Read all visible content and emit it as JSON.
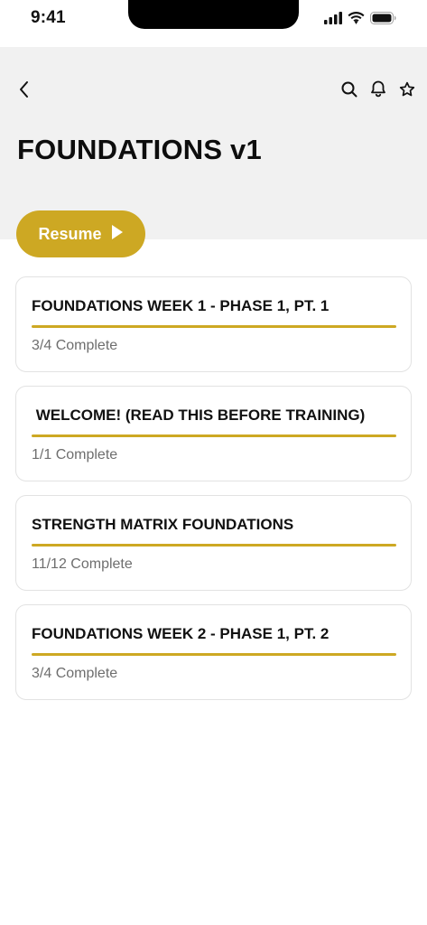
{
  "status_bar": {
    "time": "9:41",
    "icons": [
      "signal-icon",
      "wifi-icon",
      "battery-icon"
    ]
  },
  "header": {
    "title": "FOUNDATIONS v1",
    "icons": {
      "back": "chevron-left-icon",
      "search": "search-icon",
      "notifications": "bell-icon",
      "favorite": "star-icon"
    }
  },
  "resume": {
    "label": "Resume",
    "icon": "play-icon"
  },
  "colors": {
    "accent": "#cda823",
    "header_bg": "#f1f1f1",
    "card_border": "#e2e2e2",
    "muted_text": "#6e6e6e"
  },
  "cards": [
    {
      "title": "FOUNDATIONS WEEK 1 - PHASE 1, PT. 1",
      "status": "3/4 Complete",
      "progress": 1.0
    },
    {
      "title": " WELCOME! (READ THIS BEFORE TRAINING)",
      "status": "1/1 Complete",
      "progress": 1.0
    },
    {
      "title": "STRENGTH MATRIX FOUNDATIONS",
      "status": "11/12 Complete",
      "progress": 1.0
    },
    {
      "title": "FOUNDATIONS WEEK 2 - PHASE 1, PT. 2",
      "status": "3/4 Complete",
      "progress": 1.0
    }
  ]
}
